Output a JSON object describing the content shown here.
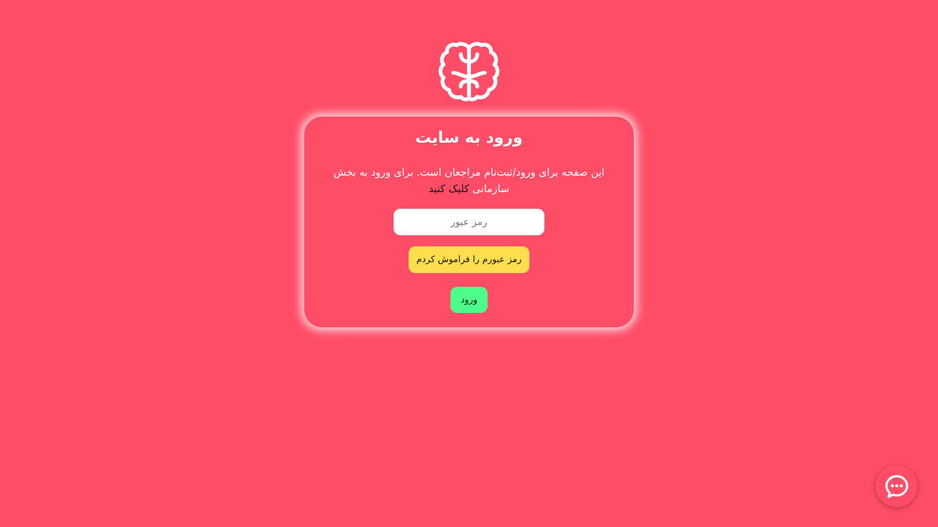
{
  "brand": {
    "logo_icon": "brain-icon",
    "background_color": "#ff4d67"
  },
  "login_card": {
    "title": "ورود به سایت",
    "description": "این صفحه برای ورود/ثبت‌نام مراجعان است. برای ورود به بخش سازمانی",
    "org_link_text": "کلیک کنید",
    "password_placeholder": "رمز عبور",
    "password_value": "",
    "forgot_button_label": "رمز عبورم را فراموش کردم",
    "login_button_label": "ورود"
  },
  "chat_widget": {
    "icon": "chat-bubble-icon"
  },
  "colors": {
    "forgot_button": "#ffde4d",
    "login_button": "#4dff8a",
    "card_glow": "#ffffff"
  }
}
